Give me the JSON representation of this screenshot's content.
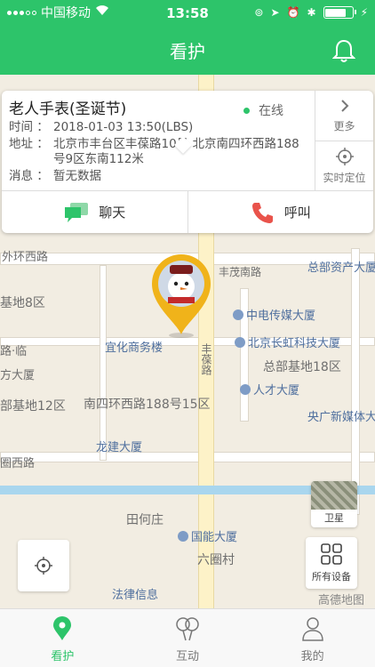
{
  "status_bar": {
    "carrier": "中国移动",
    "time": "13:58"
  },
  "header": {
    "title": "看护"
  },
  "device": {
    "name": "老人手表(圣诞节)",
    "status": "在线",
    "time_label": "时间 ：",
    "time_value": "2018-01-03 13:50(LBS)",
    "address_label": "地址 ：",
    "address_value": "北京市丰台区丰葆路10号 北京南四环西路188号9区东南112米",
    "message_label": "消息 ：",
    "message_value": "暂无数据"
  },
  "side_buttons": {
    "more": "更多",
    "realtime": "实时定位"
  },
  "actions": {
    "chat": "聊天",
    "call": "呼叫"
  },
  "map": {
    "labels": [
      "外环西路",
      "基地8区",
      "路·临",
      "方大厦",
      "部基地12区",
      "南四环西路188号15区",
      "圈西路",
      "田何庄",
      "六圈村",
      "丰茂南路",
      "丰葆路",
      "总部基地18区"
    ],
    "pois": [
      "总部资产大厦",
      "中电传媒大厦",
      "北京长虹科技大厦",
      "宜化商务楼",
      "人才大厦",
      "央广新媒体大",
      "龙建大厦",
      "国能大厦",
      "法律信息"
    ],
    "satellite_label": "卫星",
    "all_devices_label": "所有设备",
    "brand": "高德地图"
  },
  "tabs": [
    {
      "label": "看护",
      "active": true
    },
    {
      "label": "互动",
      "active": false
    },
    {
      "label": "我的",
      "active": false
    }
  ],
  "colors": {
    "brand": "#2dc46a",
    "marker": "#f0b31a",
    "call": "#e9534b"
  }
}
